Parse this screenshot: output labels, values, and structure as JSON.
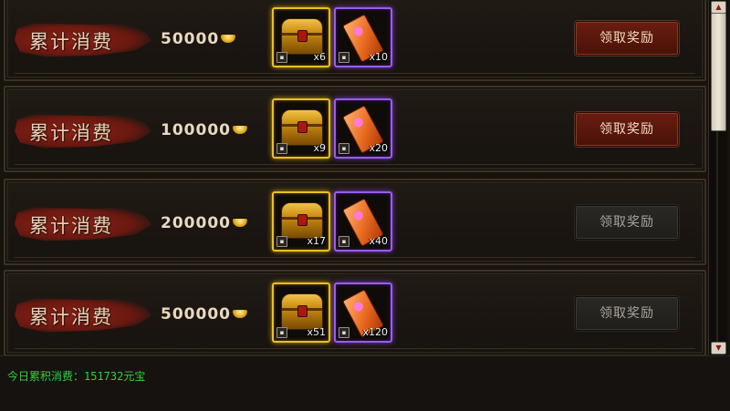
{
  "tiers": [
    {
      "label": "累计消费",
      "amount": "50000",
      "items": [
        {
          "qty": "x6",
          "icon": "treasure-chest"
        },
        {
          "qty": "x10",
          "icon": "scroll-ticket"
        }
      ],
      "button": "领取奖励",
      "claimable": true
    },
    {
      "label": "累计消费",
      "amount": "100000",
      "items": [
        {
          "qty": "x9",
          "icon": "treasure-chest"
        },
        {
          "qty": "x20",
          "icon": "scroll-ticket"
        }
      ],
      "button": "领取奖励",
      "claimable": true
    },
    {
      "label": "累计消费",
      "amount": "200000",
      "items": [
        {
          "qty": "x17",
          "icon": "treasure-chest"
        },
        {
          "qty": "x40",
          "icon": "scroll-ticket"
        }
      ],
      "button": "领取奖励",
      "claimable": false
    },
    {
      "label": "累计消费",
      "amount": "500000",
      "items": [
        {
          "qty": "x51",
          "icon": "treasure-chest"
        },
        {
          "qty": "x120",
          "icon": "scroll-ticket"
        }
      ],
      "button": "领取奖励",
      "claimable": false
    }
  ],
  "footer": {
    "text": "今日累积消费：151732元宝"
  },
  "colors": {
    "accent_red": "#6a1d10",
    "gold_frame": "#e9c020",
    "purple_frame": "#9b5ce8",
    "footer_green": "#2ed43a"
  }
}
